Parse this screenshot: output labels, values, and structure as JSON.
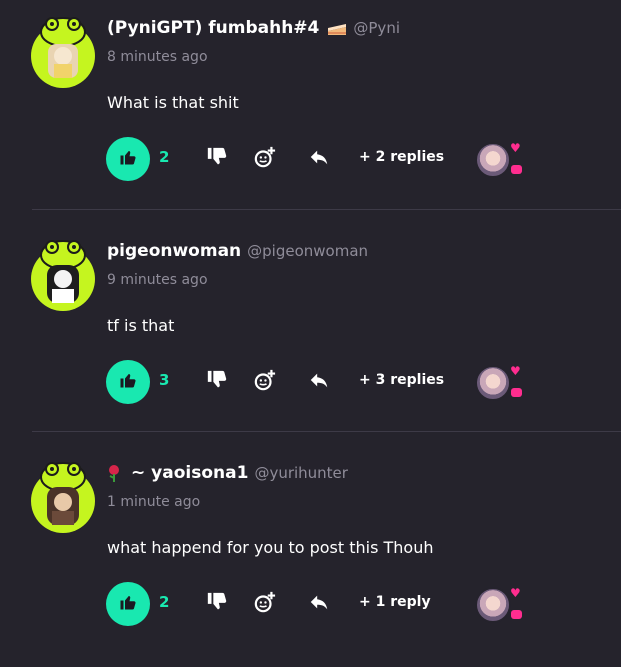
{
  "comments": [
    {
      "username": "(PyniGPT) fumbahh#4",
      "handle": "@Pyni",
      "time": "8 minutes ago",
      "text": "What is that shit",
      "likes": "2",
      "replies": "+ 2 replies",
      "badge": "cake-icon"
    },
    {
      "username": "pigeonwoman",
      "handle": "@pigeonwoman",
      "time": "9 minutes ago",
      "text": "tf is that",
      "likes": "3",
      "replies": "+ 3 replies",
      "badge": ""
    },
    {
      "username": "~ yaoisona1",
      "handle": "@yurihunter",
      "time": "1 minute ago",
      "text": "what happend for you to post this Thouh",
      "likes": "2",
      "replies": "+ 1 reply",
      "badge": "rose-icon"
    }
  ],
  "colors": {
    "background": "#25232c",
    "accent": "#19e8b0",
    "avatar_frame": "#c5f51f",
    "muted": "#8f8c99",
    "reaction_pink": "#ff2d8f"
  },
  "icons": {
    "like": "thumbs-up-icon",
    "dislike": "thumbs-down-icon",
    "react": "add-reaction-icon",
    "reply": "reply-arrow-icon"
  }
}
